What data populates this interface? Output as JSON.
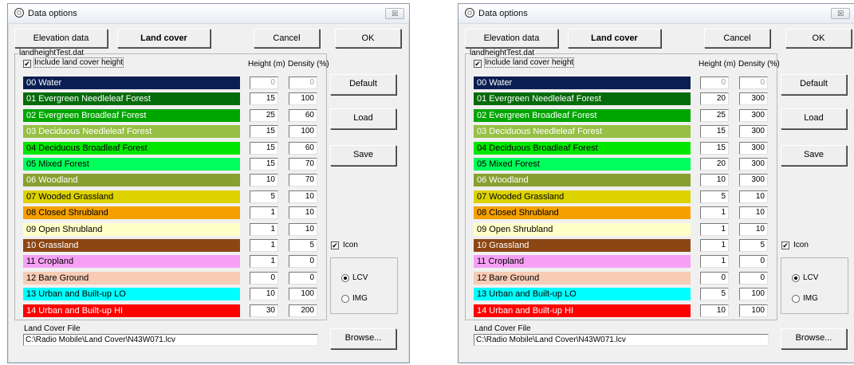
{
  "dialogs": [
    {
      "title": "Data options",
      "close_label": "☒",
      "tabs": [
        "Elevation data",
        "Land cover"
      ],
      "cancel_label": "Cancel",
      "ok_label": "OK",
      "group_title": "landheightTest.dat",
      "include_height_label": "Include land cover height",
      "include_height_checked": true,
      "height_header": "Height (m)",
      "density_header": "Density (%)",
      "classes": [
        {
          "name": "00  Water",
          "bg": "#0a1e52",
          "fg": "#ffffff",
          "height": "0",
          "density": "0",
          "disabled": true
        },
        {
          "name": "01  Evergreen Needleleaf Forest",
          "bg": "#066b0a",
          "fg": "#ffffff",
          "height": "15",
          "density": "100"
        },
        {
          "name": "02  Evergreen Broadleaf Forest",
          "bg": "#00a600",
          "fg": "#ffffff",
          "height": "25",
          "density": "60"
        },
        {
          "name": "03  Deciduous Needleleaf Forest",
          "bg": "#96c046",
          "fg": "#ffffff",
          "height": "15",
          "density": "100"
        },
        {
          "name": "04  Deciduous Broadleaf Forest",
          "bg": "#00e600",
          "fg": "#000000",
          "height": "15",
          "density": "60"
        },
        {
          "name": "05  Mixed Forest",
          "bg": "#00ff5a",
          "fg": "#000000",
          "height": "15",
          "density": "70"
        },
        {
          "name": "06  Woodland",
          "bg": "#88a030",
          "fg": "#ffffff",
          "height": "10",
          "density": "70"
        },
        {
          "name": "07  Wooded Grassland",
          "bg": "#dcd200",
          "fg": "#000000",
          "height": "5",
          "density": "10"
        },
        {
          "name": "08  Closed Shrubland",
          "bg": "#f5a000",
          "fg": "#000000",
          "height": "1",
          "density": "10"
        },
        {
          "name": "09  Open Shrubland",
          "bg": "#ffffc8",
          "fg": "#000000",
          "height": "1",
          "density": "10"
        },
        {
          "name": "10  Grassland",
          "bg": "#8c4614",
          "fg": "#ffffff",
          "height": "1",
          "density": "5"
        },
        {
          "name": "11  Cropland",
          "bg": "#f5a0f5",
          "fg": "#000000",
          "height": "1",
          "density": "0"
        },
        {
          "name": "12  Bare Ground",
          "bg": "#f7cbb4",
          "fg": "#000000",
          "height": "0",
          "density": "0"
        },
        {
          "name": "13  Urban and Built-up LO",
          "bg": "#00ffff",
          "fg": "#000000",
          "height": "10",
          "density": "100"
        },
        {
          "name": "14  Urban and Built-up HI",
          "bg": "#ff0000",
          "fg": "#ffffff",
          "height": "30",
          "density": "200"
        }
      ],
      "default_label": "Default",
      "load_label": "Load",
      "save_label": "Save",
      "icon_label": "Icon",
      "icon_checked": true,
      "lcv_label": "LCV",
      "img_label": "IMG",
      "selected_format": "LCV",
      "file_label": "Land Cover File",
      "file_path": "C:\\Radio Mobile\\Land Cover\\N43W071.lcv",
      "browse_label": "Browse..."
    },
    {
      "title": "Data options",
      "close_label": "☒",
      "tabs": [
        "Elevation data",
        "Land cover"
      ],
      "cancel_label": "Cancel",
      "ok_label": "OK",
      "group_title": "landheightTest.dat",
      "include_height_label": "Include land cover height",
      "include_height_checked": true,
      "height_header": "Height (m)",
      "density_header": "Density (%)",
      "classes": [
        {
          "name": "00  Water",
          "bg": "#0a1e52",
          "fg": "#ffffff",
          "height": "0",
          "density": "0",
          "disabled": true
        },
        {
          "name": "01  Evergreen Needleleaf Forest",
          "bg": "#066b0a",
          "fg": "#ffffff",
          "height": "20",
          "density": "300"
        },
        {
          "name": "02  Evergreen Broadleaf Forest",
          "bg": "#00a600",
          "fg": "#ffffff",
          "height": "25",
          "density": "300"
        },
        {
          "name": "03  Deciduous Needleleaf Forest",
          "bg": "#96c046",
          "fg": "#ffffff",
          "height": "15",
          "density": "300"
        },
        {
          "name": "04  Deciduous Broadleaf Forest",
          "bg": "#00e600",
          "fg": "#000000",
          "height": "15",
          "density": "300"
        },
        {
          "name": "05  Mixed Forest",
          "bg": "#00ff5a",
          "fg": "#000000",
          "height": "20",
          "density": "300"
        },
        {
          "name": "06  Woodland",
          "bg": "#88a030",
          "fg": "#ffffff",
          "height": "10",
          "density": "300"
        },
        {
          "name": "07  Wooded Grassland",
          "bg": "#dcd200",
          "fg": "#000000",
          "height": "5",
          "density": "10"
        },
        {
          "name": "08  Closed Shrubland",
          "bg": "#f5a000",
          "fg": "#000000",
          "height": "1",
          "density": "10"
        },
        {
          "name": "09  Open Shrubland",
          "bg": "#ffffc8",
          "fg": "#000000",
          "height": "1",
          "density": "10"
        },
        {
          "name": "10  Grassland",
          "bg": "#8c4614",
          "fg": "#ffffff",
          "height": "1",
          "density": "5"
        },
        {
          "name": "11  Cropland",
          "bg": "#f5a0f5",
          "fg": "#000000",
          "height": "1",
          "density": "0"
        },
        {
          "name": "12  Bare Ground",
          "bg": "#f7cbb4",
          "fg": "#000000",
          "height": "0",
          "density": "0"
        },
        {
          "name": "13  Urban and Built-up LO",
          "bg": "#00ffff",
          "fg": "#000000",
          "height": "5",
          "density": "100"
        },
        {
          "name": "14  Urban and Built-up HI",
          "bg": "#ff0000",
          "fg": "#ffffff",
          "height": "10",
          "density": "100"
        }
      ],
      "default_label": "Default",
      "load_label": "Load",
      "save_label": "Save",
      "icon_label": "Icon",
      "icon_checked": true,
      "lcv_label": "LCV",
      "img_label": "IMG",
      "selected_format": "LCV",
      "file_label": "Land Cover File",
      "file_path": "C:\\Radio Mobile\\Land Cover\\N43W071.lcv",
      "browse_label": "Browse..."
    }
  ]
}
